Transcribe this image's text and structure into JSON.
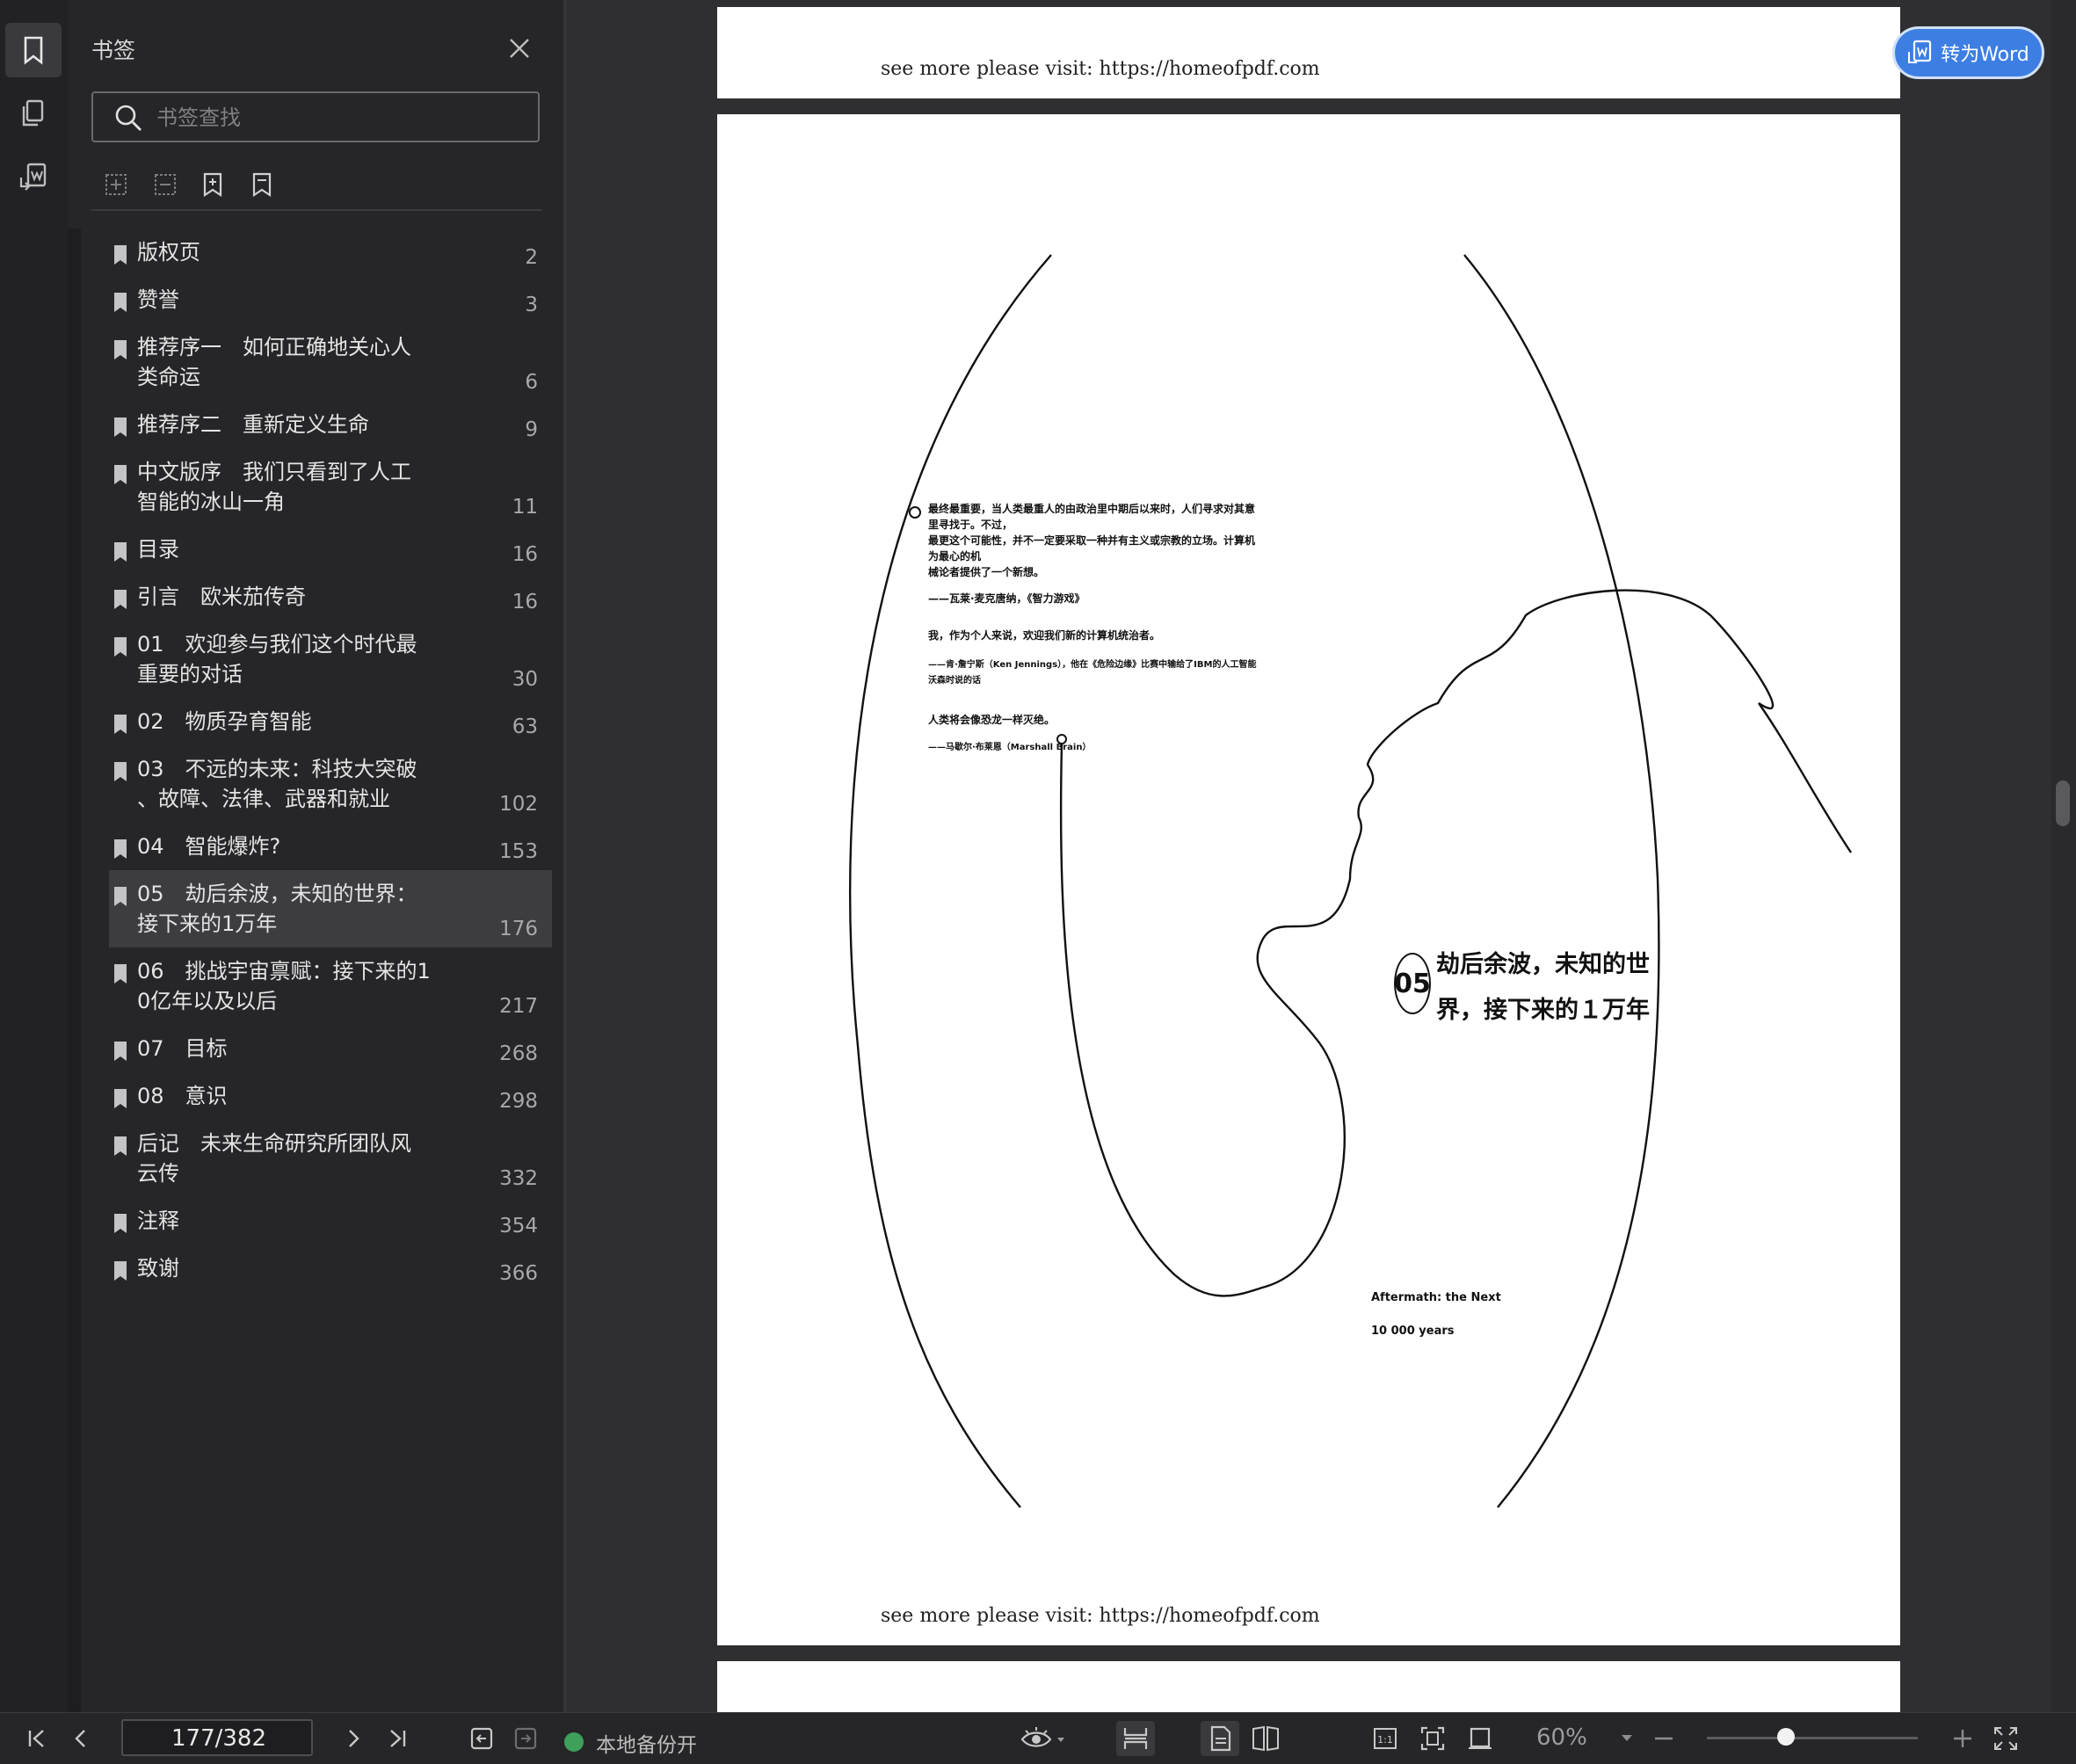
{
  "sidebar": {
    "title": "书签",
    "search_placeholder": "书签查找",
    "bookmarks": [
      {
        "label": "版权页",
        "page": "2"
      },
      {
        "label": "赞誉",
        "page": "3"
      },
      {
        "label": "推荐序一　如何正确地关心人\n类命运",
        "page": "6"
      },
      {
        "label": "推荐序二　重新定义生命",
        "page": "9"
      },
      {
        "label": "中文版序　我们只看到了人工\n智能的冰山一角",
        "page": "11"
      },
      {
        "label": "目录",
        "page": "16"
      },
      {
        "label": "引言　欧米茄传奇",
        "page": "16"
      },
      {
        "label": "01　欢迎参与我们这个时代最\n重要的对话",
        "page": "30"
      },
      {
        "label": "02　物质孕育智能",
        "page": "63"
      },
      {
        "label": "03　不远的未来：科技大突破\n、故障、法律、武器和就业",
        "page": "102"
      },
      {
        "label": "04　智能爆炸?",
        "page": "153"
      },
      {
        "label": "05　劫后余波，未知的世界：\n接下来的1万年",
        "page": "176",
        "selected": true
      },
      {
        "label": "06　挑战宇宙禀赋：接下来的1\n0亿年以及以后",
        "page": "217"
      },
      {
        "label": "07　目标",
        "page": "268"
      },
      {
        "label": "08　意识",
        "page": "298"
      },
      {
        "label": "后记　未来生命研究所团队风\n云传",
        "page": "332"
      },
      {
        "label": "注释",
        "page": "354"
      },
      {
        "label": "致谢",
        "page": "366"
      }
    ]
  },
  "document": {
    "footer_link_top": "see more please visit: https://homeofpdf.com",
    "footer_link_bottom": "see more please visit: https://homeofpdf.com",
    "quote_line1": "最终最重要，当人类最重人的由政治里中期后以来时，人们寻求对其意里寻找于。不过，",
    "quote_line2": "最更这个可能性，并不一定要采取一种并有主义或宗教的立场。计算机为最心的机",
    "quote_line3": "械论者提供了一个新想。",
    "quote_attr1": "——瓦莱·麦克唐纳，《智力游戏》",
    "quote_line4": "我，作为个人来说，欢迎我们新的计算机统治者。",
    "quote_attr2": "——肯·詹宁斯（Ken Jennings），他在《危险边缘》比赛中输给了IBM的人工智能沃森时说的话",
    "quote_line5": "人类将会像恐龙一样灭绝。",
    "quote_attr3": "——马歇尔·布莱恩（Marshall Brain）",
    "chapter_num": "05",
    "chapter_title_l1": "劫后余波，未知的世",
    "chapter_title_l2": "界，接下来的１万年",
    "chapter_en_l1": "Aftermath: the Next",
    "chapter_en_l2": "10 000 years"
  },
  "word_button": {
    "label": "转为Word"
  },
  "statusbar": {
    "current_page": "177/382",
    "backup_text": "本地备份开",
    "zoom": "60%",
    "zoom_level_percent": 60
  }
}
